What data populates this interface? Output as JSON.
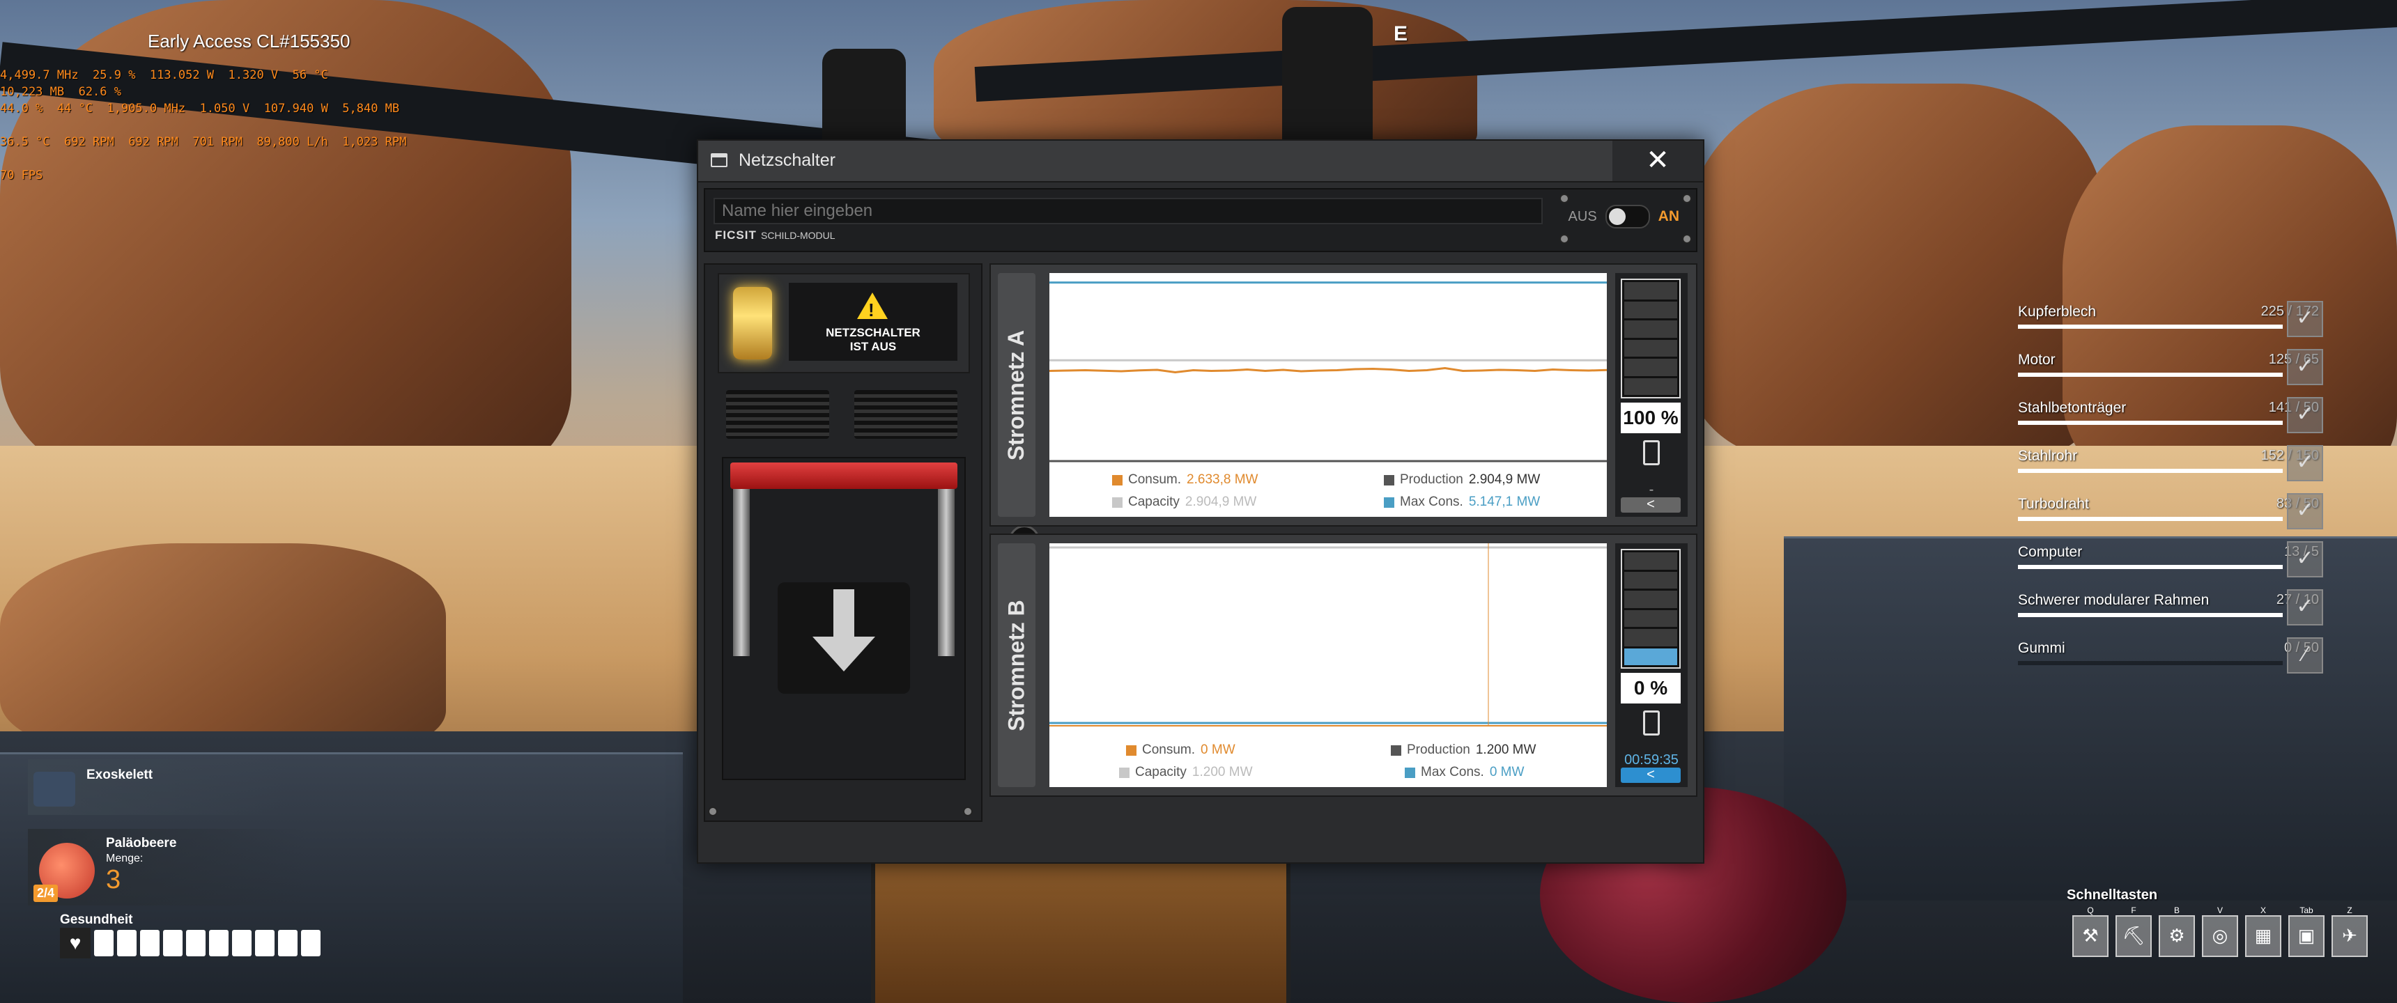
{
  "hud": {
    "build": "Early Access CL#155350",
    "stats": [
      "4,499.7 MHz  25.9 %  113.052 W  1.320 V  56 °C",
      "10,223 MB  62.6 %",
      "44.0 %  44 °C  1,905.0 MHz  1.050 V  107.940 W  5,840 MB",
      "",
      "36.5 °C  692 RPM  692 RPM  701 RPM  89,800 L/h  1,023 RPM",
      "",
      "70 FPS"
    ],
    "interact_key": "E"
  },
  "dialog": {
    "title": "Netzschalter",
    "close_label": "✕",
    "name_placeholder": "Name hier eingeben",
    "brand": "FICSIT",
    "module": "SCHILD-MODUL",
    "toggle_off": "AUS",
    "toggle_on": "AN",
    "warning_line1": "NETZSCHALTER",
    "warning_line2": "IST AUS",
    "warning_glyph": "!",
    "grid_a": {
      "label": "Stromnetz A",
      "consum_label": "Consum.",
      "consum_value": "2.633,8 MW",
      "production_label": "Production",
      "production_value": "2.904,9 MW",
      "capacity_label": "Capacity",
      "capacity_value": "2.904,9 MW",
      "maxcons_label": "Max Cons.",
      "maxcons_value": "5.147,1 MW",
      "battery_pct": "100 %",
      "battery_time": "-",
      "battery_level": 0,
      "button_label": "<"
    },
    "grid_b": {
      "label": "Stromnetz B",
      "consum_label": "Consum.",
      "consum_value": "0 MW",
      "production_label": "Production",
      "production_value": "1.200 MW",
      "capacity_label": "Capacity",
      "capacity_value": "1.200 MW",
      "maxcons_label": "Max Cons.",
      "maxcons_value": "0 MW",
      "battery_pct": "0 %",
      "battery_time": "00:59:35",
      "battery_level": 1,
      "button_label": "<"
    },
    "colors": {
      "consum": "#e08a2e",
      "production": "#555555",
      "capacity": "#c8c8c8",
      "maxcons": "#4a9ec4"
    }
  },
  "chart_data": [
    {
      "type": "line",
      "title": "Stromnetz A",
      "series": [
        {
          "name": "Consum.",
          "values": [
            2600,
            2610,
            2620,
            2605,
            2590,
            2615,
            2630,
            2560,
            2620,
            2600,
            2610,
            2640,
            2600,
            2630,
            2590,
            2610,
            2620,
            2650,
            2660,
            2640,
            2600,
            2620,
            2680,
            2600,
            2610,
            2630,
            2620,
            2600,
            2640,
            2620,
            2610,
            2625
          ]
        },
        {
          "name": "Capacity",
          "values": [
            2904.9
          ]
        },
        {
          "name": "Max Cons.",
          "values": [
            5147.1
          ]
        }
      ],
      "ylim": [
        0,
        5300
      ]
    },
    {
      "type": "line",
      "title": "Stromnetz B",
      "series": [
        {
          "name": "Consum.",
          "values": [
            0
          ]
        },
        {
          "name": "Capacity",
          "values": [
            1200
          ]
        },
        {
          "name": "Max Cons.",
          "values": [
            0
          ]
        }
      ]
    }
  ],
  "checklist": [
    {
      "name": "Kupferblech",
      "count": "225 / 172",
      "progress": 1.0
    },
    {
      "name": "Motor",
      "count": "125 / 65",
      "progress": 1.0
    },
    {
      "name": "Stahlbetonträger",
      "count": "141 / 50",
      "progress": 1.0
    },
    {
      "name": "Stahlrohr",
      "count": "152 / 150",
      "progress": 1.0
    },
    {
      "name": "Turbodraht",
      "count": "83 / 50",
      "progress": 1.0
    },
    {
      "name": "Computer",
      "count": "13 / 5",
      "progress": 1.0
    },
    {
      "name": "Schwerer modularer Rahmen",
      "count": "27 / 10",
      "progress": 1.0
    },
    {
      "name": "Gummi",
      "count": "0 / 50",
      "progress": 0.0
    }
  ],
  "player": {
    "equipment": "Exoskelett",
    "item_name": "Paläobeere",
    "qty_label": "Menge:",
    "qty_value": "3",
    "stack": "2/4",
    "health_label": "Gesundheit",
    "health_segments": 10
  },
  "hotbar": {
    "title": "Schnelltasten",
    "slots": [
      {
        "key": "Q",
        "icon": "hammer-icon",
        "glyph": "⚒"
      },
      {
        "key": "F",
        "icon": "dismantle-icon",
        "glyph": "⛏"
      },
      {
        "key": "B",
        "icon": "build-gun-icon",
        "glyph": "⚙"
      },
      {
        "key": "V",
        "icon": "scanner-icon",
        "glyph": "◎"
      },
      {
        "key": "X",
        "icon": "foundation-icon",
        "glyph": "▦"
      },
      {
        "key": "Tab",
        "icon": "inventory-icon",
        "glyph": "▣"
      },
      {
        "key": "Z",
        "icon": "tool-icon",
        "glyph": "✈"
      }
    ]
  }
}
